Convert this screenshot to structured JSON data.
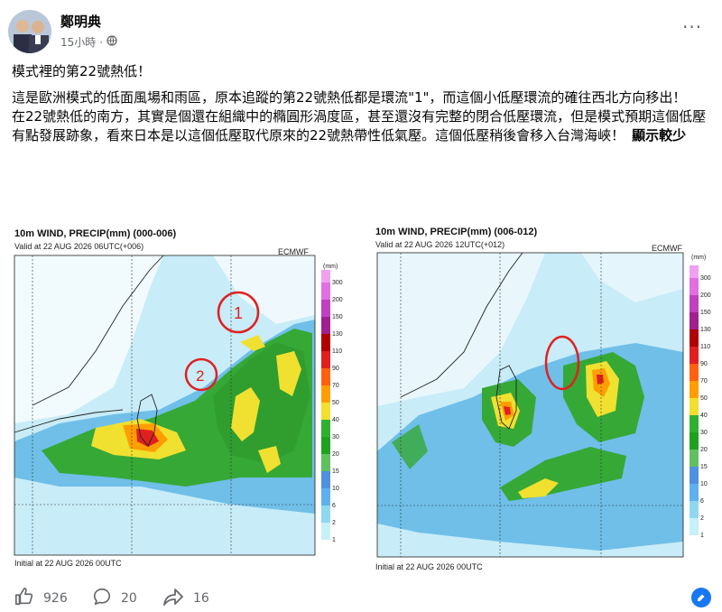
{
  "post": {
    "author": "鄭明典",
    "time": "15小時",
    "dot": "·",
    "headline": "模式裡的第22號熱低！",
    "para1": "這是歐洲模式的低面風場和雨區，原本追蹤的第22號熱低都是環流\"1\"，而這個小低壓環流的確往西北方向移出！",
    "para2": "在22號熱低的南方，其實是個還在組織中的橢圓形渦度區，甚至還沒有完整的閉合低壓環流，但是模式預期這個低壓有點發展跡象，看來日本是以這個低壓取代原來的22號熱帶性低氣壓。這個低壓稍後會移入台灣海峽！",
    "see_more": "顯示較少"
  },
  "map_left": {
    "title": "10m WIND, PRECIP(mm) (000-006)",
    "valid": "Valid at 22 AUG 2026 06UTC(+006)",
    "model": "ECMWF",
    "unit": "(mm)",
    "initial": "Initial at 22 AUG 2026 00UTC",
    "marker1": "1",
    "marker2": "2"
  },
  "map_right": {
    "title": "10m WIND, PRECIP(mm) (006-012)",
    "valid": "Valid at 22 AUG 2026 12UTC(+012)",
    "model": "ECMWF",
    "unit": "(mm)",
    "initial": "Initial at 22 AUG 2026 00UTC"
  },
  "colorbar": {
    "levels": [
      "300",
      "200",
      "150",
      "130",
      "110",
      "90",
      "70",
      "50",
      "40",
      "30",
      "20",
      "15",
      "10",
      "6",
      "2",
      "1"
    ],
    "colors": [
      "#f0a0f0",
      "#e070e0",
      "#c040c0",
      "#a02090",
      "#b00000",
      "#e02020",
      "#ff6010",
      "#ff9e00",
      "#f0e030",
      "#30b030",
      "#20a020",
      "#60c060",
      "#5090e0",
      "#60b0f0",
      "#90d8f0",
      "#c8f0f8"
    ]
  },
  "reactions": {
    "likes": "926",
    "comments": "20",
    "shares": "16"
  },
  "icons": [
    "avatar",
    "globe-icon",
    "more-icon",
    "like-icon",
    "comment-icon",
    "share-icon",
    "edit-icon"
  ]
}
